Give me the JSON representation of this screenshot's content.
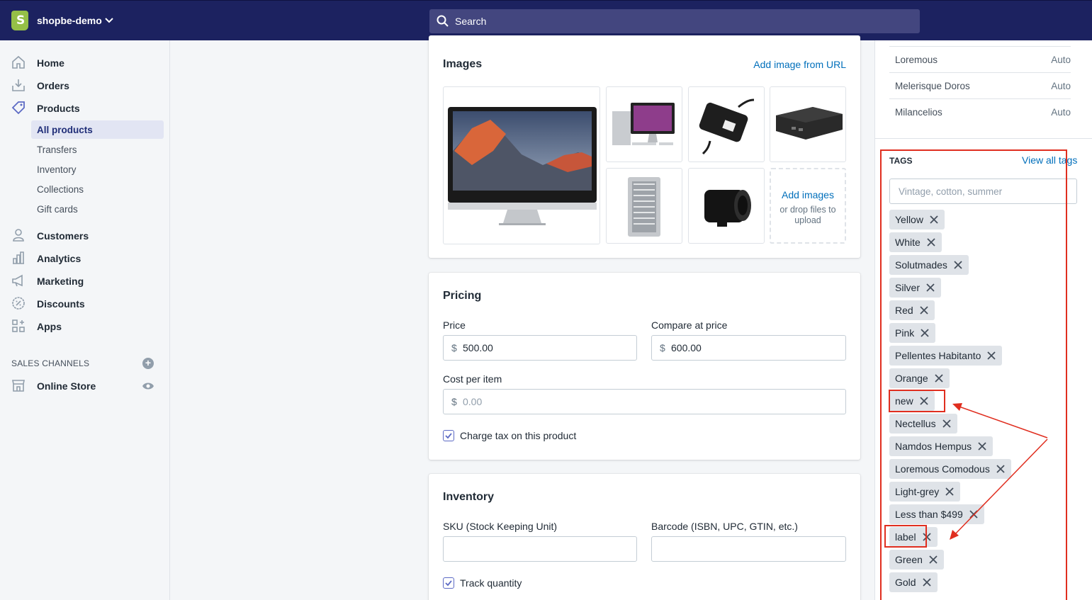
{
  "store": {
    "name": "shopbe-demo"
  },
  "search": {
    "placeholder": "Search"
  },
  "sidebar": {
    "items": [
      {
        "label": "Home",
        "icon": "home-icon"
      },
      {
        "label": "Orders",
        "icon": "orders-icon"
      },
      {
        "label": "Products",
        "icon": "tag-icon"
      },
      {
        "label": "Customers",
        "icon": "person-icon"
      },
      {
        "label": "Analytics",
        "icon": "bar-chart-icon"
      },
      {
        "label": "Marketing",
        "icon": "megaphone-icon"
      },
      {
        "label": "Discounts",
        "icon": "discount-icon"
      },
      {
        "label": "Apps",
        "icon": "apps-icon"
      }
    ],
    "products_sub": [
      "All products",
      "Transfers",
      "Inventory",
      "Collections",
      "Gift cards"
    ],
    "sales_channels_title": "SALES CHANNELS",
    "online_store": "Online Store"
  },
  "images_card": {
    "title": "Images",
    "add_url": "Add image from URL",
    "add_images": "Add images",
    "drop_text": "or drop files to upload"
  },
  "pricing": {
    "title": "Pricing",
    "price_label": "Price",
    "price_value": "500.00",
    "compare_label": "Compare at price",
    "compare_value": "600.00",
    "cost_label": "Cost per item",
    "cost_placeholder": "0.00",
    "currency": "$",
    "charge_tax": "Charge tax on this product"
  },
  "inventory": {
    "title": "Inventory",
    "sku_label": "SKU (Stock Keeping Unit)",
    "barcode_label": "Barcode (ISBN, UPC, GTIN, etc.)",
    "track_quantity": "Track quantity"
  },
  "collections": [
    {
      "name": "Loremous",
      "mode": "Auto"
    },
    {
      "name": "Melerisque Doros",
      "mode": "Auto"
    },
    {
      "name": "Milancelios",
      "mode": "Auto"
    }
  ],
  "tags": {
    "title": "TAGS",
    "view_all": "View all tags",
    "placeholder": "Vintage, cotton, summer",
    "items": [
      "Yellow",
      "White",
      "Solutmades",
      "Silver",
      "Red",
      "Pink",
      "Pellentes Habitanto",
      "Orange",
      "new",
      "Nectellus",
      "Namdos Hempus",
      "Loremous Comodous",
      "Light-grey",
      "Less than $499",
      "label",
      "Green",
      "Gold"
    ]
  },
  "colors": {
    "topbar": "#1c2260",
    "accent": "#5c6ac4",
    "link": "#006fbb",
    "annotation": "#e02e1f"
  }
}
